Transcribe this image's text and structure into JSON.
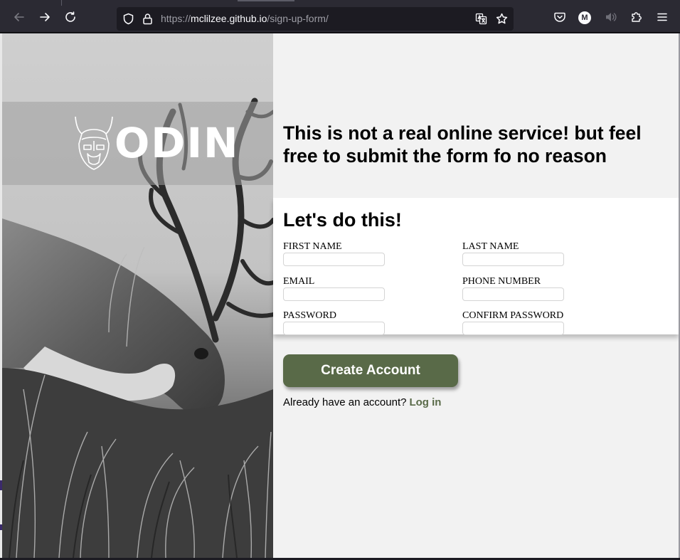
{
  "browser": {
    "url_scheme": "https://",
    "url_host": "mclilzee.github.io",
    "url_path": "/sign-up-form/",
    "profile_initial": "M"
  },
  "page": {
    "logo_text": "ODIN",
    "headline": "This is not a real online service! but feel free to submit the form fo no reason",
    "form_title": "Let's do this!",
    "fields": {
      "first_name": {
        "label": "FIRST NAME",
        "value": ""
      },
      "last_name": {
        "label": "LAST NAME",
        "value": ""
      },
      "email": {
        "label": "EMAIL",
        "value": ""
      },
      "phone": {
        "label": "PHONE NUMBER",
        "value": ""
      },
      "password": {
        "label": "PASSWORD",
        "value": ""
      },
      "confirm_password": {
        "label": "CONFIRM PASSWORD",
        "value": ""
      }
    },
    "create_button": "Create Account",
    "login_prompt": "Already have an account?",
    "login_link": "Log in"
  },
  "colors": {
    "accent": "#596a48",
    "toolbar": "#2b2a33",
    "page_bg": "#f2f2f2"
  },
  "icons": [
    "back-arrow-icon",
    "forward-arrow-icon",
    "reload-icon",
    "shield-icon",
    "lock-icon",
    "translate-icon",
    "bookmark-star-icon",
    "pocket-icon",
    "profile-avatar-icon",
    "speaker-icon",
    "extensions-icon",
    "menu-icon"
  ]
}
